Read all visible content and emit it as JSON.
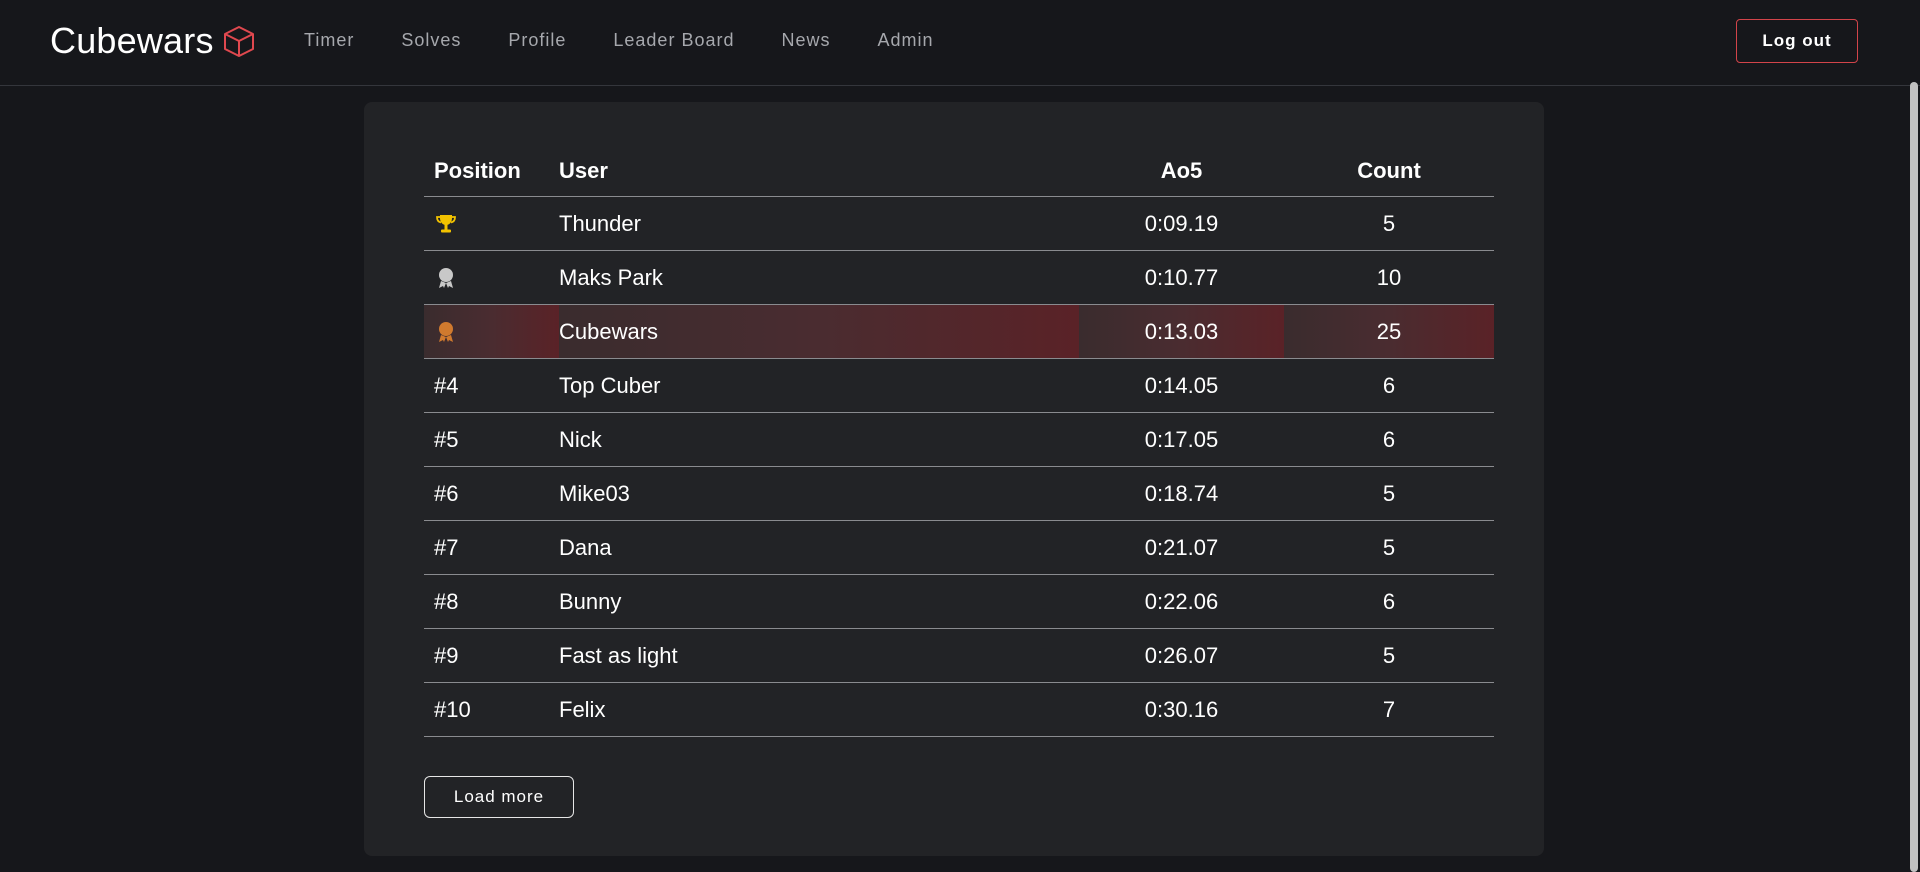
{
  "brand": {
    "name": "Cubewars",
    "logo_icon": "cube-icon",
    "logo_color": "#e0484f"
  },
  "nav": {
    "links": [
      "Timer",
      "Solves",
      "Profile",
      "Leader Board",
      "News",
      "Admin"
    ],
    "logout_label": "Log out",
    "logout_border_color": "#d2444a"
  },
  "leaderboard": {
    "headers": {
      "position": "Position",
      "user": "User",
      "ao5": "Ao5",
      "count": "Count"
    },
    "rows": [
      {
        "position": "",
        "icon": "trophy-icon",
        "icon_color": "#f2c200",
        "user": "Thunder",
        "ao5": "0:09.19",
        "count": "5",
        "highlighted": false
      },
      {
        "position": "",
        "icon": "silver-medal-icon",
        "icon_color": "#c8c8c8",
        "user": "Maks Park",
        "ao5": "0:10.77",
        "count": "10",
        "highlighted": false
      },
      {
        "position": "",
        "icon": "bronze-medal-icon",
        "icon_color": "#d07a2e",
        "user": "Cubewars",
        "ao5": "0:13.03",
        "count": "25",
        "highlighted": true
      },
      {
        "position": "#4",
        "icon": "",
        "user": "Top Cuber",
        "ao5": "0:14.05",
        "count": "6",
        "highlighted": false
      },
      {
        "position": "#5",
        "icon": "",
        "user": "Nick",
        "ao5": "0:17.05",
        "count": "6",
        "highlighted": false
      },
      {
        "position": "#6",
        "icon": "",
        "user": "Mike03",
        "ao5": "0:18.74",
        "count": "5",
        "highlighted": false
      },
      {
        "position": "#7",
        "icon": "",
        "user": "Dana",
        "ao5": "0:21.07",
        "count": "5",
        "highlighted": false
      },
      {
        "position": "#8",
        "icon": "",
        "user": "Bunny",
        "ao5": "0:22.06",
        "count": "6",
        "highlighted": false
      },
      {
        "position": "#9",
        "icon": "",
        "user": "Fast as light",
        "ao5": "0:26.07",
        "count": "5",
        "highlighted": false
      },
      {
        "position": "#10",
        "icon": "",
        "user": "Felix",
        "ao5": "0:30.16",
        "count": "7",
        "highlighted": false
      }
    ],
    "load_more_label": "Load more"
  }
}
